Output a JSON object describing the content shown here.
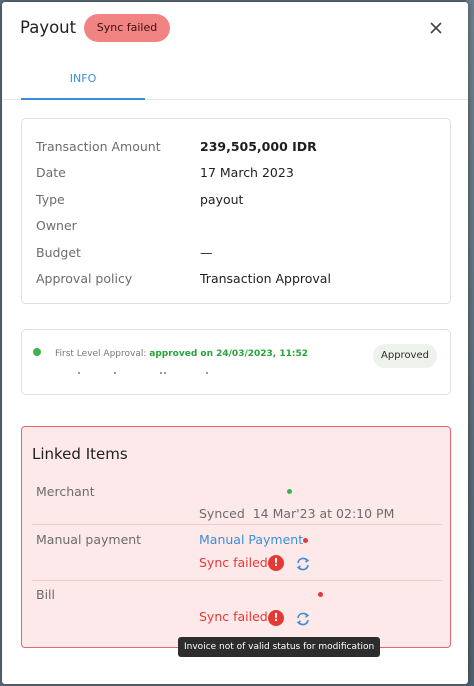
{
  "modal": {
    "title": "Payout",
    "status_badge": "Sync failed",
    "close_icon": "close-icon"
  },
  "tabs": [
    {
      "label": "INFO",
      "active": true
    }
  ],
  "info": {
    "rows": [
      {
        "label": "Transaction Amount",
        "value": "239,505,000 IDR"
      },
      {
        "label": "Date",
        "value": "17 March 2023"
      },
      {
        "label": "Type",
        "value": "payout"
      },
      {
        "label": "Owner",
        "value": ""
      },
      {
        "label": "Budget",
        "value": "—"
      },
      {
        "label": "Approval policy",
        "value": "Transaction Approval"
      }
    ]
  },
  "approval": {
    "level_label": "First Level Approval:",
    "status_text": "approved on 24/03/2023, 11:52",
    "badge": "Approved"
  },
  "linked_items": {
    "title": "Linked Items",
    "merchant": {
      "label": "Merchant",
      "synced_label": "Synced",
      "synced_time": "14 Mar'23 at 02:10 PM"
    },
    "manual_payment": {
      "label": "Manual payment",
      "link": "Manual Payment",
      "status": "Sync failed",
      "warn_glyph": "!"
    },
    "bill": {
      "label": "Bill",
      "status": "Sync failed",
      "warn_glyph": "!"
    }
  },
  "tooltip": {
    "text": "Invoice not of valid status for modification"
  },
  "colors": {
    "accent": "#3b8ed8",
    "error": "#e53935",
    "success": "#3bb54a",
    "badge_failed_bg": "#f28383",
    "linked_bg": "#fde9e9"
  }
}
